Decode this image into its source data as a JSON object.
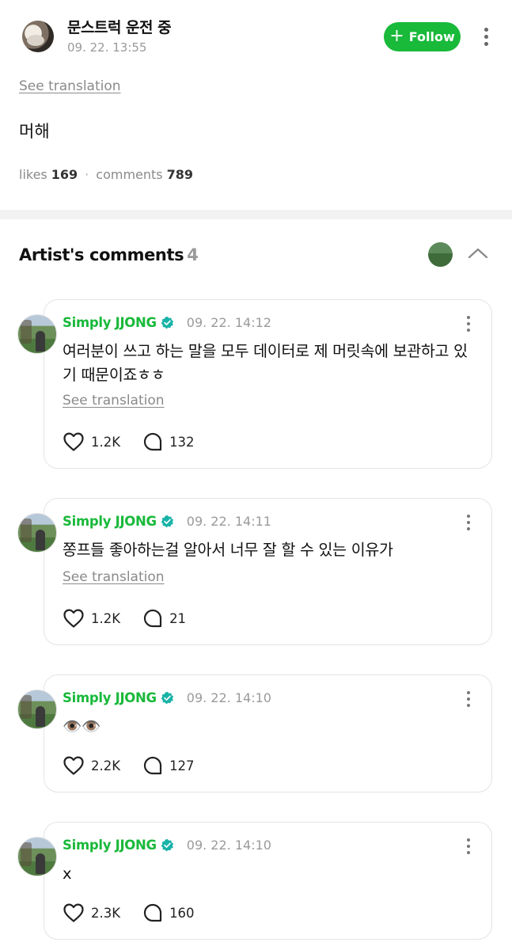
{
  "post": {
    "author": "문스트럭 운전 중",
    "time": "09. 22. 13:55",
    "follow_label": "Follow",
    "see_translation": "See translation",
    "body": "머해",
    "likes_label": "likes",
    "likes_count": "169",
    "comments_label": "comments",
    "comments_count": "789"
  },
  "section": {
    "title": "Artist's comments",
    "count": "4"
  },
  "colors": {
    "accent_green": "#19b93a",
    "verified_teal": "#19b3a8"
  },
  "comments": [
    {
      "author": "Simply JJONG",
      "time": "09. 22. 14:12",
      "text": "여러분이 쓰고 하는 말을 모두 데이터로 제 머릿속에 보관하고 있기 때문이죠ㅎㅎ",
      "see_translation": "See translation",
      "likes": "1.2K",
      "replies": "132"
    },
    {
      "author": "Simply JJONG",
      "time": "09. 22. 14:11",
      "text": "쫑프들 좋아하는걸 알아서 너무 잘 할 수 있는 이유가",
      "see_translation": "See translation",
      "likes": "1.2K",
      "replies": "21"
    },
    {
      "author": "Simply JJONG",
      "time": "09. 22. 14:10",
      "text": "👁️👁️",
      "likes": "2.2K",
      "replies": "127"
    },
    {
      "author": "Simply JJONG",
      "time": "09. 22. 14:10",
      "text": "x",
      "likes": "2.3K",
      "replies": "160"
    }
  ]
}
